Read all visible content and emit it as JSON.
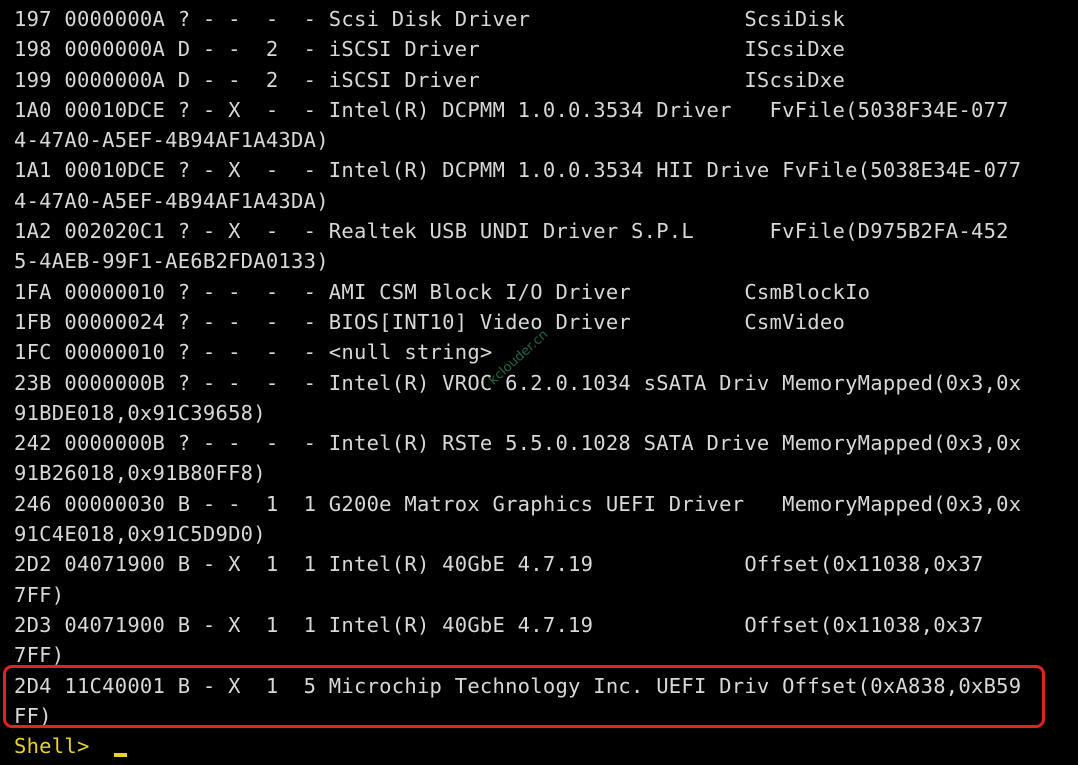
{
  "terminal": {
    "lines": [
      "197 0000000A ? - -  -  - Scsi Disk Driver                 ScsiDisk",
      "198 0000000A D - -  2  - iSCSI Driver                     IScsiDxe",
      "199 0000000A D - -  2  - iSCSI Driver                     IScsiDxe",
      "1A0 00010DCE ? - X  -  - Intel(R) DCPMM 1.0.0.3534 Driver   FvFile(5038F34E-077",
      "4-47A0-A5EF-4B94AF1A43DA)",
      "1A1 00010DCE ? - X  -  - Intel(R) DCPMM 1.0.0.3534 HII Drive FvFile(5038E34E-077",
      "4-47A0-A5EF-4B94AF1A43DA)",
      "1A2 002020C1 ? - X  -  - Realtek USB UNDI Driver S.P.L      FvFile(D975B2FA-452",
      "5-4AEB-99F1-AE6B2FDA0133)",
      "1FA 00000010 ? - -  -  - AMI CSM Block I/O Driver         CsmBlockIo",
      "1FB 00000024 ? - -  -  - BIOS[INT10] Video Driver         CsmVideo",
      "1FC 00000010 ? - -  -  - <null string>",
      "23B 0000000B ? - -  -  - Intel(R) VROC 6.2.0.1034 sSATA Driv MemoryMapped(0x3,0x",
      "91BDE018,0x91C39658)",
      "242 0000000B ? - -  -  - Intel(R) RSTe 5.5.0.1028 SATA Drive MemoryMapped(0x3,0x",
      "91B26018,0x91B80FF8)",
      "246 00000030 B - -  1  1 G200e Matrox Graphics UEFI Driver   MemoryMapped(0x3,0x",
      "91C4E018,0x91C5D9D0)",
      "2D2 04071900 B - X  1  1 Intel(R) 40GbE 4.7.19            Offset(0x11038,0x37",
      "7FF)",
      "2D3 04071900 B - X  1  1 Intel(R) 40GbE 4.7.19            Offset(0x11038,0x37",
      "7FF)",
      "2D4 11C40001 B - X  1  5 Microchip Technology Inc. UEFI Driv Offset(0xA838,0xB59",
      "FF)"
    ],
    "prompt": "Shell> "
  },
  "watermark": "kclouder.cn",
  "colors": {
    "background": "#000000",
    "text": "#d8d8d8",
    "prompt": "#e8d22c",
    "highlight": "#e02424"
  }
}
